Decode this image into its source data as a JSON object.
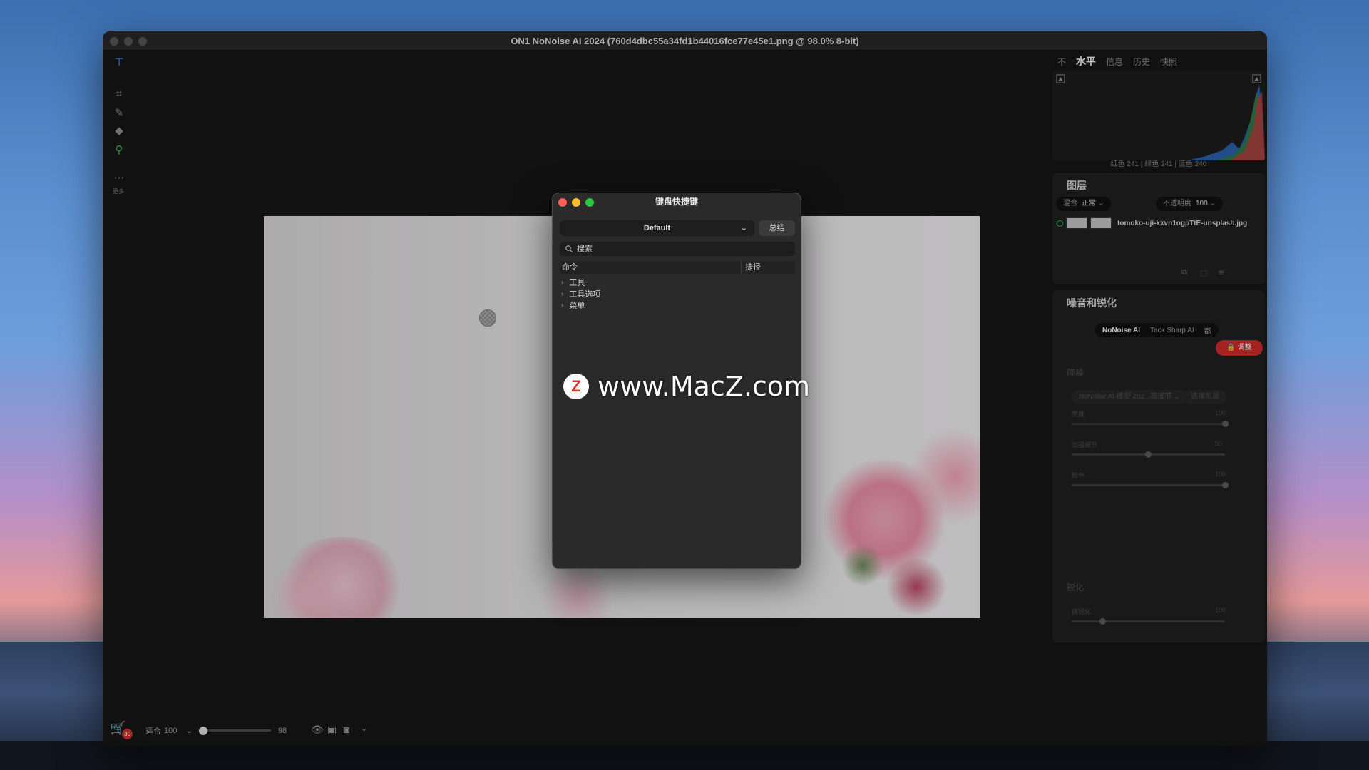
{
  "window": {
    "title": "ON1 NoNoise AI 2024 (760d4dbc55a34fd1b44016fce77e45e1.png @ 98.0% 8-bit)"
  },
  "left_toolbar": {
    "more_label": "更多",
    "cart_badge": "30"
  },
  "bottom_bar": {
    "fit_label": "适合",
    "zoom_value": "100",
    "slider_value": "98",
    "zoom_slider_fraction": 0.05
  },
  "right_panel": {
    "tabs": [
      "不",
      "水平",
      "信息",
      "历史",
      "快照"
    ],
    "active_tab": "水平",
    "histogram_readout": "红色 241 | 绿色 241 | 蓝色 240",
    "layers": {
      "title": "图层",
      "blend_label": "混合",
      "blend_value": "正常",
      "opacity_label": "不透明度",
      "opacity_value": "100",
      "layer_name": "tomoko-uji-kxvn1ogpTtE-unsplash.jpg"
    },
    "noise": {
      "title": "噪音和锐化",
      "modes": [
        "NoNoise AI",
        "Tack Sharp AI",
        "都"
      ],
      "active_mode": "NoNoise AI",
      "adjust_label": "调整",
      "denoise_title": "降噪",
      "model_label": "NoNoise AI 模型",
      "model_value": "202...高细节",
      "mask_button": "选择车是",
      "sliders": [
        {
          "label": "亮度",
          "value": "100",
          "fraction": 1.0
        },
        {
          "label": "加强细节",
          "value": "50",
          "fraction": 0.5
        },
        {
          "label": "颜色",
          "value": "100",
          "fraction": 1.0
        }
      ],
      "sharpen_title": "锐化",
      "sharpen_sliders": [
        {
          "label": "微锐化",
          "value": "100",
          "fraction": 0.2
        }
      ]
    }
  },
  "dialog": {
    "title": "键盘快捷键",
    "preset": "Default",
    "summary_button": "总结",
    "search_placeholder": "搜索",
    "columns": {
      "command": "命令",
      "shortcut": "捷径"
    },
    "tree_items": [
      "工具",
      "工具选项",
      "菜单"
    ]
  },
  "watermark": {
    "logo_letter": "Z",
    "text": "www.MacZ.com"
  },
  "colors": {
    "accent_green": "#37b24d",
    "adjust_red": "#c92a2a",
    "traffic_red": "#ff5f57",
    "traffic_yellow": "#febc2e",
    "traffic_green": "#28c840"
  }
}
